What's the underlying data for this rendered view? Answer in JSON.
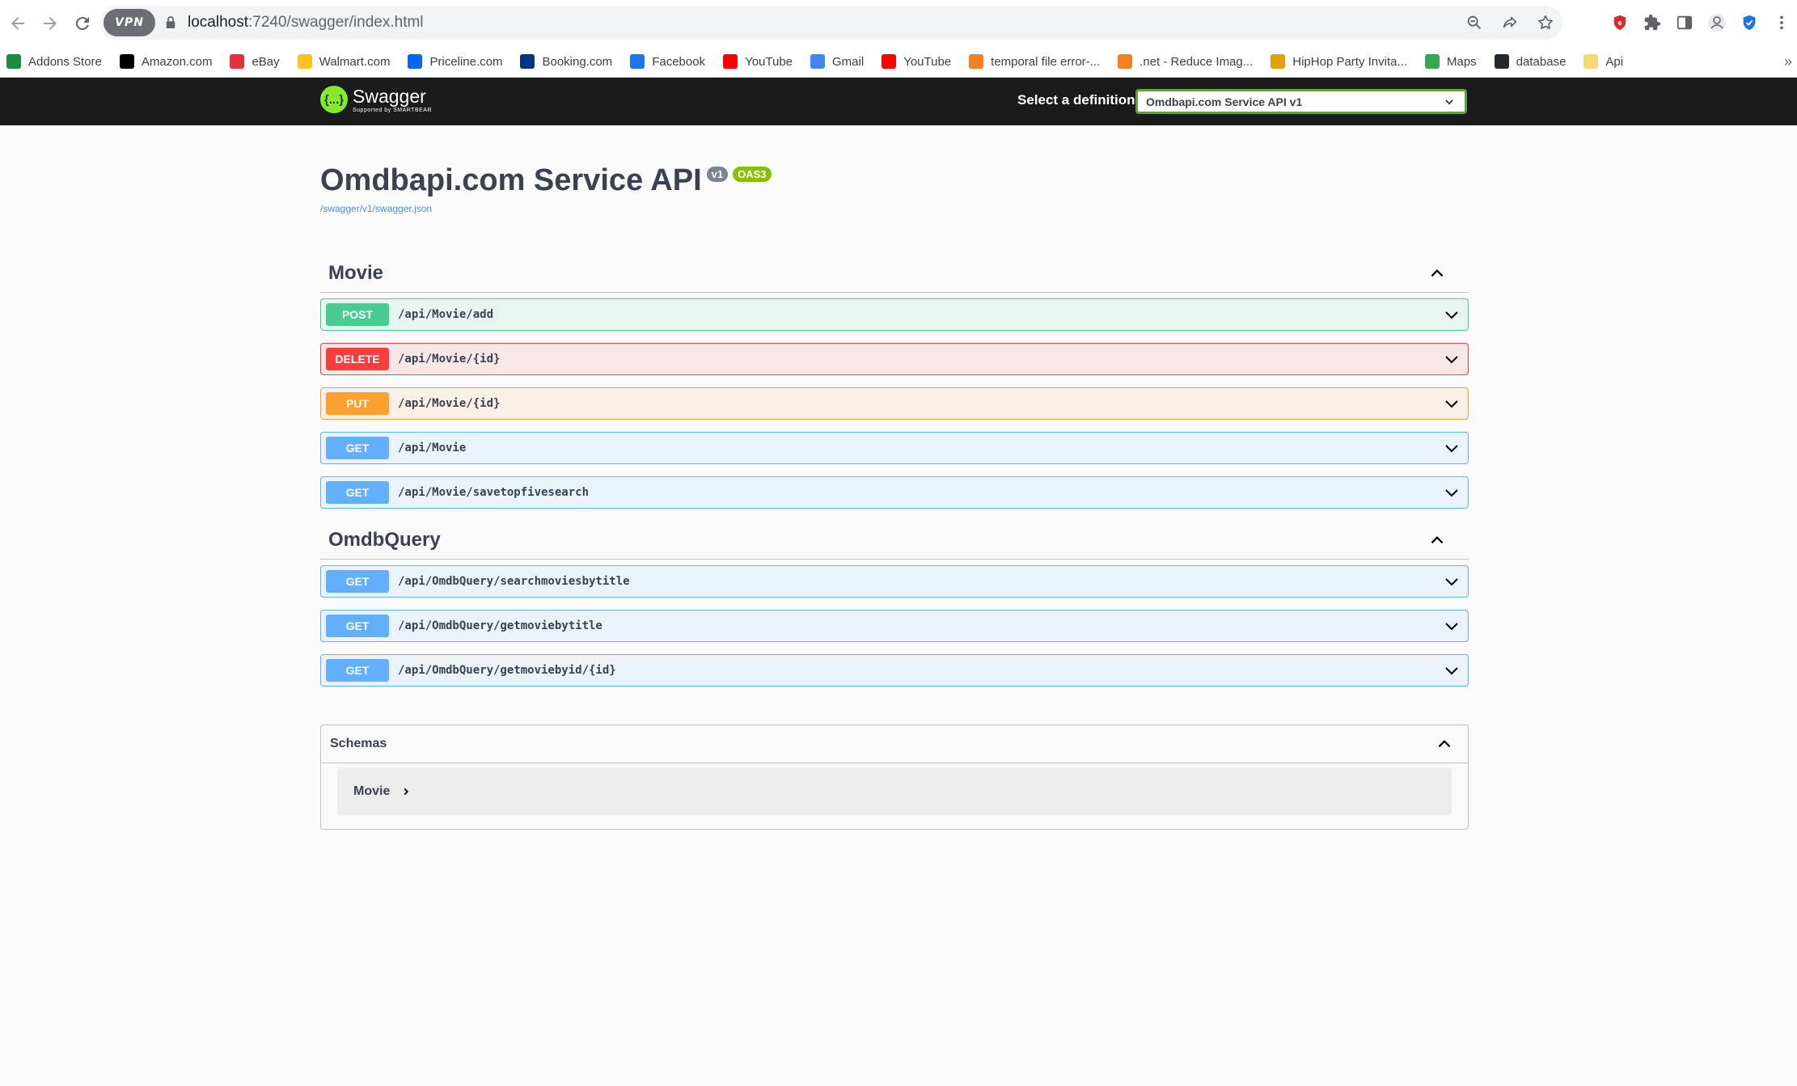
{
  "browser": {
    "url_host": "localhost",
    "url_rest": ":7240/swagger/index.html",
    "vpn_label": "VPN",
    "bookmarks": [
      {
        "label": "Addons Store",
        "icon": "addons-store-icon",
        "color": "#1a8d3c"
      },
      {
        "label": "Amazon.com",
        "icon": "amazon-icon",
        "color": "#000000"
      },
      {
        "label": "eBay",
        "icon": "ebay-icon",
        "color": "#e53238"
      },
      {
        "label": "Walmart.com",
        "icon": "walmart-icon",
        "color": "#ffc220"
      },
      {
        "label": "Priceline.com",
        "icon": "priceline-icon",
        "color": "#0068ef"
      },
      {
        "label": "Booking.com",
        "icon": "booking-icon",
        "color": "#003580"
      },
      {
        "label": "Facebook",
        "icon": "facebook-icon",
        "color": "#1877f2"
      },
      {
        "label": "YouTube",
        "icon": "youtube-icon",
        "color": "#ff0000"
      },
      {
        "label": "Gmail",
        "icon": "google-icon",
        "color": "#4285f4"
      },
      {
        "label": "YouTube",
        "icon": "youtube-icon",
        "color": "#ff0000"
      },
      {
        "label": "temporal file error-...",
        "icon": "stackoverflow-icon",
        "color": "#f48024"
      },
      {
        "label": ".net - Reduce Imag...",
        "icon": "stackoverflow-icon",
        "color": "#f48024"
      },
      {
        "label": "HipHop Party Invita...",
        "icon": "bee-icon",
        "color": "#e0a000"
      },
      {
        "label": "Maps",
        "icon": "maps-icon",
        "color": "#34a853"
      },
      {
        "label": "database",
        "icon": "github-icon",
        "color": "#24292e"
      },
      {
        "label": "Api",
        "icon": "folder-icon",
        "color": "#f7d774"
      }
    ],
    "more_label": "»"
  },
  "swagger": {
    "logo_text": "Swagger",
    "logo_sub": "Supported by SMARTBEAR",
    "logo_glyph": "{...}",
    "select_label": "Select a definition",
    "select_value": "Omdbapi.com Service API v1"
  },
  "info": {
    "title": "Omdbapi.com Service API",
    "version": "v1",
    "oas": "OAS3",
    "spec_link": "/swagger/v1/swagger.json"
  },
  "tags": [
    {
      "name": "Movie",
      "operations": [
        {
          "method": "POST",
          "cls": "post",
          "path": "/api/Movie/add"
        },
        {
          "method": "DELETE",
          "cls": "delete",
          "path": "/api/Movie/{id}"
        },
        {
          "method": "PUT",
          "cls": "put",
          "path": "/api/Movie/{id}"
        },
        {
          "method": "GET",
          "cls": "get",
          "path": "/api/Movie"
        },
        {
          "method": "GET",
          "cls": "get",
          "path": "/api/Movie/savetopfivesearch"
        }
      ]
    },
    {
      "name": "OmdbQuery",
      "operations": [
        {
          "method": "GET",
          "cls": "get",
          "path": "/api/OmdbQuery/searchmoviesbytitle"
        },
        {
          "method": "GET",
          "cls": "get",
          "path": "/api/OmdbQuery/getmoviebytitle"
        },
        {
          "method": "GET",
          "cls": "get",
          "path": "/api/OmdbQuery/getmoviebyid/{id}"
        }
      ]
    }
  ],
  "schemas": {
    "title": "Schemas",
    "models": [
      "Movie"
    ]
  }
}
